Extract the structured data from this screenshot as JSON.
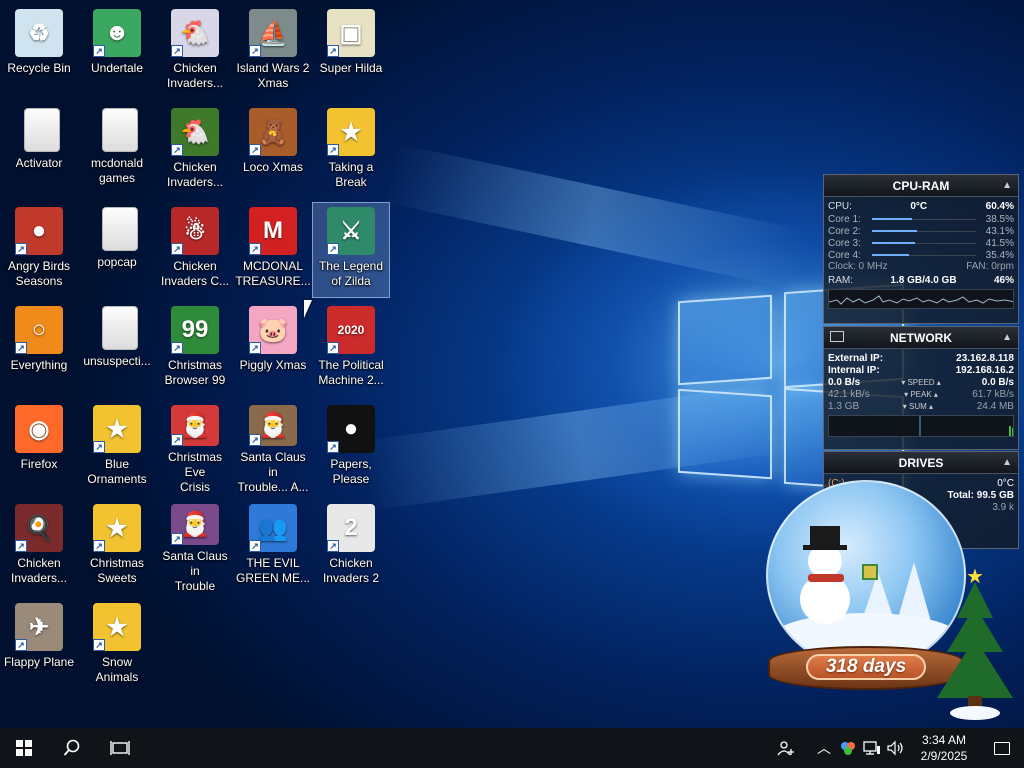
{
  "desktop": {
    "icons": [
      {
        "label": "Recycle Bin",
        "glyph": "♻",
        "color": "#cfe4ef",
        "shortcut": false
      },
      {
        "label": "Undertale",
        "glyph": "☻",
        "color": "#3aa860",
        "shortcut": true
      },
      {
        "label": "Chicken\nInvaders...",
        "glyph": "🐔",
        "color": "#d7d7e8",
        "shortcut": true
      },
      {
        "label": "Island Wars 2\nXmas",
        "glyph": "⛵",
        "color": "#7d8c8a",
        "shortcut": true
      },
      {
        "label": "Super Hilda",
        "glyph": "▣",
        "color": "#e8e2c4",
        "shortcut": true
      },
      {
        "label": "Activator",
        "glyph": "",
        "color": "folder",
        "shortcut": false
      },
      {
        "label": "mcdonald\ngames",
        "glyph": "",
        "color": "folder",
        "shortcut": false
      },
      {
        "label": "Chicken\nInvaders...",
        "glyph": "🐔",
        "color": "#3f7a2a",
        "shortcut": true
      },
      {
        "label": "Loco Xmas",
        "glyph": "🧸",
        "color": "#a85d2a",
        "shortcut": true
      },
      {
        "label": "Taking a\nBreak",
        "glyph": "★",
        "color": "#f2c230",
        "shortcut": true
      },
      {
        "label": "Angry Birds\nSeasons",
        "glyph": "●",
        "color": "#c0392b",
        "shortcut": true
      },
      {
        "label": "popcap",
        "glyph": "",
        "color": "folder",
        "shortcut": false
      },
      {
        "label": "Chicken\nInvaders C...",
        "glyph": "☃",
        "color": "#b82828",
        "shortcut": true
      },
      {
        "label": "MCDONAL\nTREASURE...",
        "glyph": "M",
        "color": "#d32020",
        "shortcut": true
      },
      {
        "label": "The Legend\nof Zilda",
        "glyph": "⚔",
        "color": "#2f8a6a",
        "shortcut": true
      },
      {
        "label": "Everything",
        "glyph": "○",
        "color": "#f08a1a",
        "shortcut": true
      },
      {
        "label": "unsuspecti...",
        "glyph": "",
        "color": "folder",
        "shortcut": false
      },
      {
        "label": "Christmas\nBrowser 99",
        "glyph": "99",
        "color": "#2e8b3a",
        "shortcut": true
      },
      {
        "label": "Piggly Xmas",
        "glyph": "🐷",
        "color": "#f5a6c2",
        "shortcut": true
      },
      {
        "label": "The Political\nMachine 2...",
        "glyph": "2020",
        "color": "#cc2b2b",
        "shortcut": true
      },
      {
        "label": "Firefox",
        "glyph": "◉",
        "color": "#ff6a2a",
        "shortcut": false
      },
      {
        "label": "Blue\nOrnaments",
        "glyph": "★",
        "color": "#f2c230",
        "shortcut": true
      },
      {
        "label": "Christmas Eve\nCrisis",
        "glyph": "🎅",
        "color": "#d43a3a",
        "shortcut": true
      },
      {
        "label": "Santa Claus in\nTrouble... A...",
        "glyph": "🎅",
        "color": "#8a6a4a",
        "shortcut": true
      },
      {
        "label": "Papers, Please",
        "glyph": "●",
        "color": "#111111",
        "shortcut": true
      },
      {
        "label": "Chicken\nInvaders...",
        "glyph": "🍳",
        "color": "#7a2a2a",
        "shortcut": true
      },
      {
        "label": "Christmas\nSweets",
        "glyph": "★",
        "color": "#f2c230",
        "shortcut": true
      },
      {
        "label": "Santa Claus in\nTrouble",
        "glyph": "🎅",
        "color": "#7a4a8a",
        "shortcut": true
      },
      {
        "label": "THE EVIL\nGREEN ME...",
        "glyph": "👥",
        "color": "#2f7ad8",
        "shortcut": true
      },
      {
        "label": "Chicken\nInvaders 2",
        "glyph": "2",
        "color": "#e8e8e8",
        "shortcut": true
      },
      {
        "label": "Flappy Plane",
        "glyph": "✈",
        "color": "#9a8a7a",
        "shortcut": true
      },
      {
        "label": "Snow\nAnimals",
        "glyph": "★",
        "color": "#f2c230",
        "shortcut": true
      }
    ]
  },
  "cpuram": {
    "title": "CPU-RAM",
    "cpu_label": "CPU:",
    "cpu_temp": "0°C",
    "cpu_percent": "60.4%",
    "cores": [
      {
        "name": "Core 1:",
        "value": "38.5%",
        "fraction": 0.385
      },
      {
        "name": "Core 2:",
        "value": "43.1%",
        "fraction": 0.431
      },
      {
        "name": "Core 3:",
        "value": "41.5%",
        "fraction": 0.415
      },
      {
        "name": "Core 4:",
        "value": "35.4%",
        "fraction": 0.354
      }
    ],
    "clock": "Clock: 0 MHz",
    "fan": "FAN: 0rpm",
    "ram_label": "RAM:",
    "ram_value": "1.8 GB/4.0 GB",
    "ram_percent": "46%"
  },
  "network": {
    "title": "NETWORK",
    "external_label": "External IP:",
    "external_ip": "23.162.8.118",
    "internal_label": "Internal IP:",
    "internal_ip": "192.168.16.2",
    "speed_down": "0.0 B/s",
    "speed_label": "SPEED",
    "speed_up": "0.0 B/s",
    "peak_down": "42.1 kB/s",
    "peak_label": "PEAK",
    "peak_up": "61.7 kB/s",
    "sum_down": "1.3 GB",
    "sum_label": "SUM",
    "sum_up": "24.4 MB"
  },
  "drives": {
    "title": "DRIVES",
    "drive": "(C:)",
    "temp": "0°C",
    "total": "Total: 99.5 GB",
    "rate": "3.9 k"
  },
  "countdown": {
    "days": "318 days"
  },
  "taskbar": {
    "time": "3:34 AM",
    "date": "2/9/2025"
  }
}
